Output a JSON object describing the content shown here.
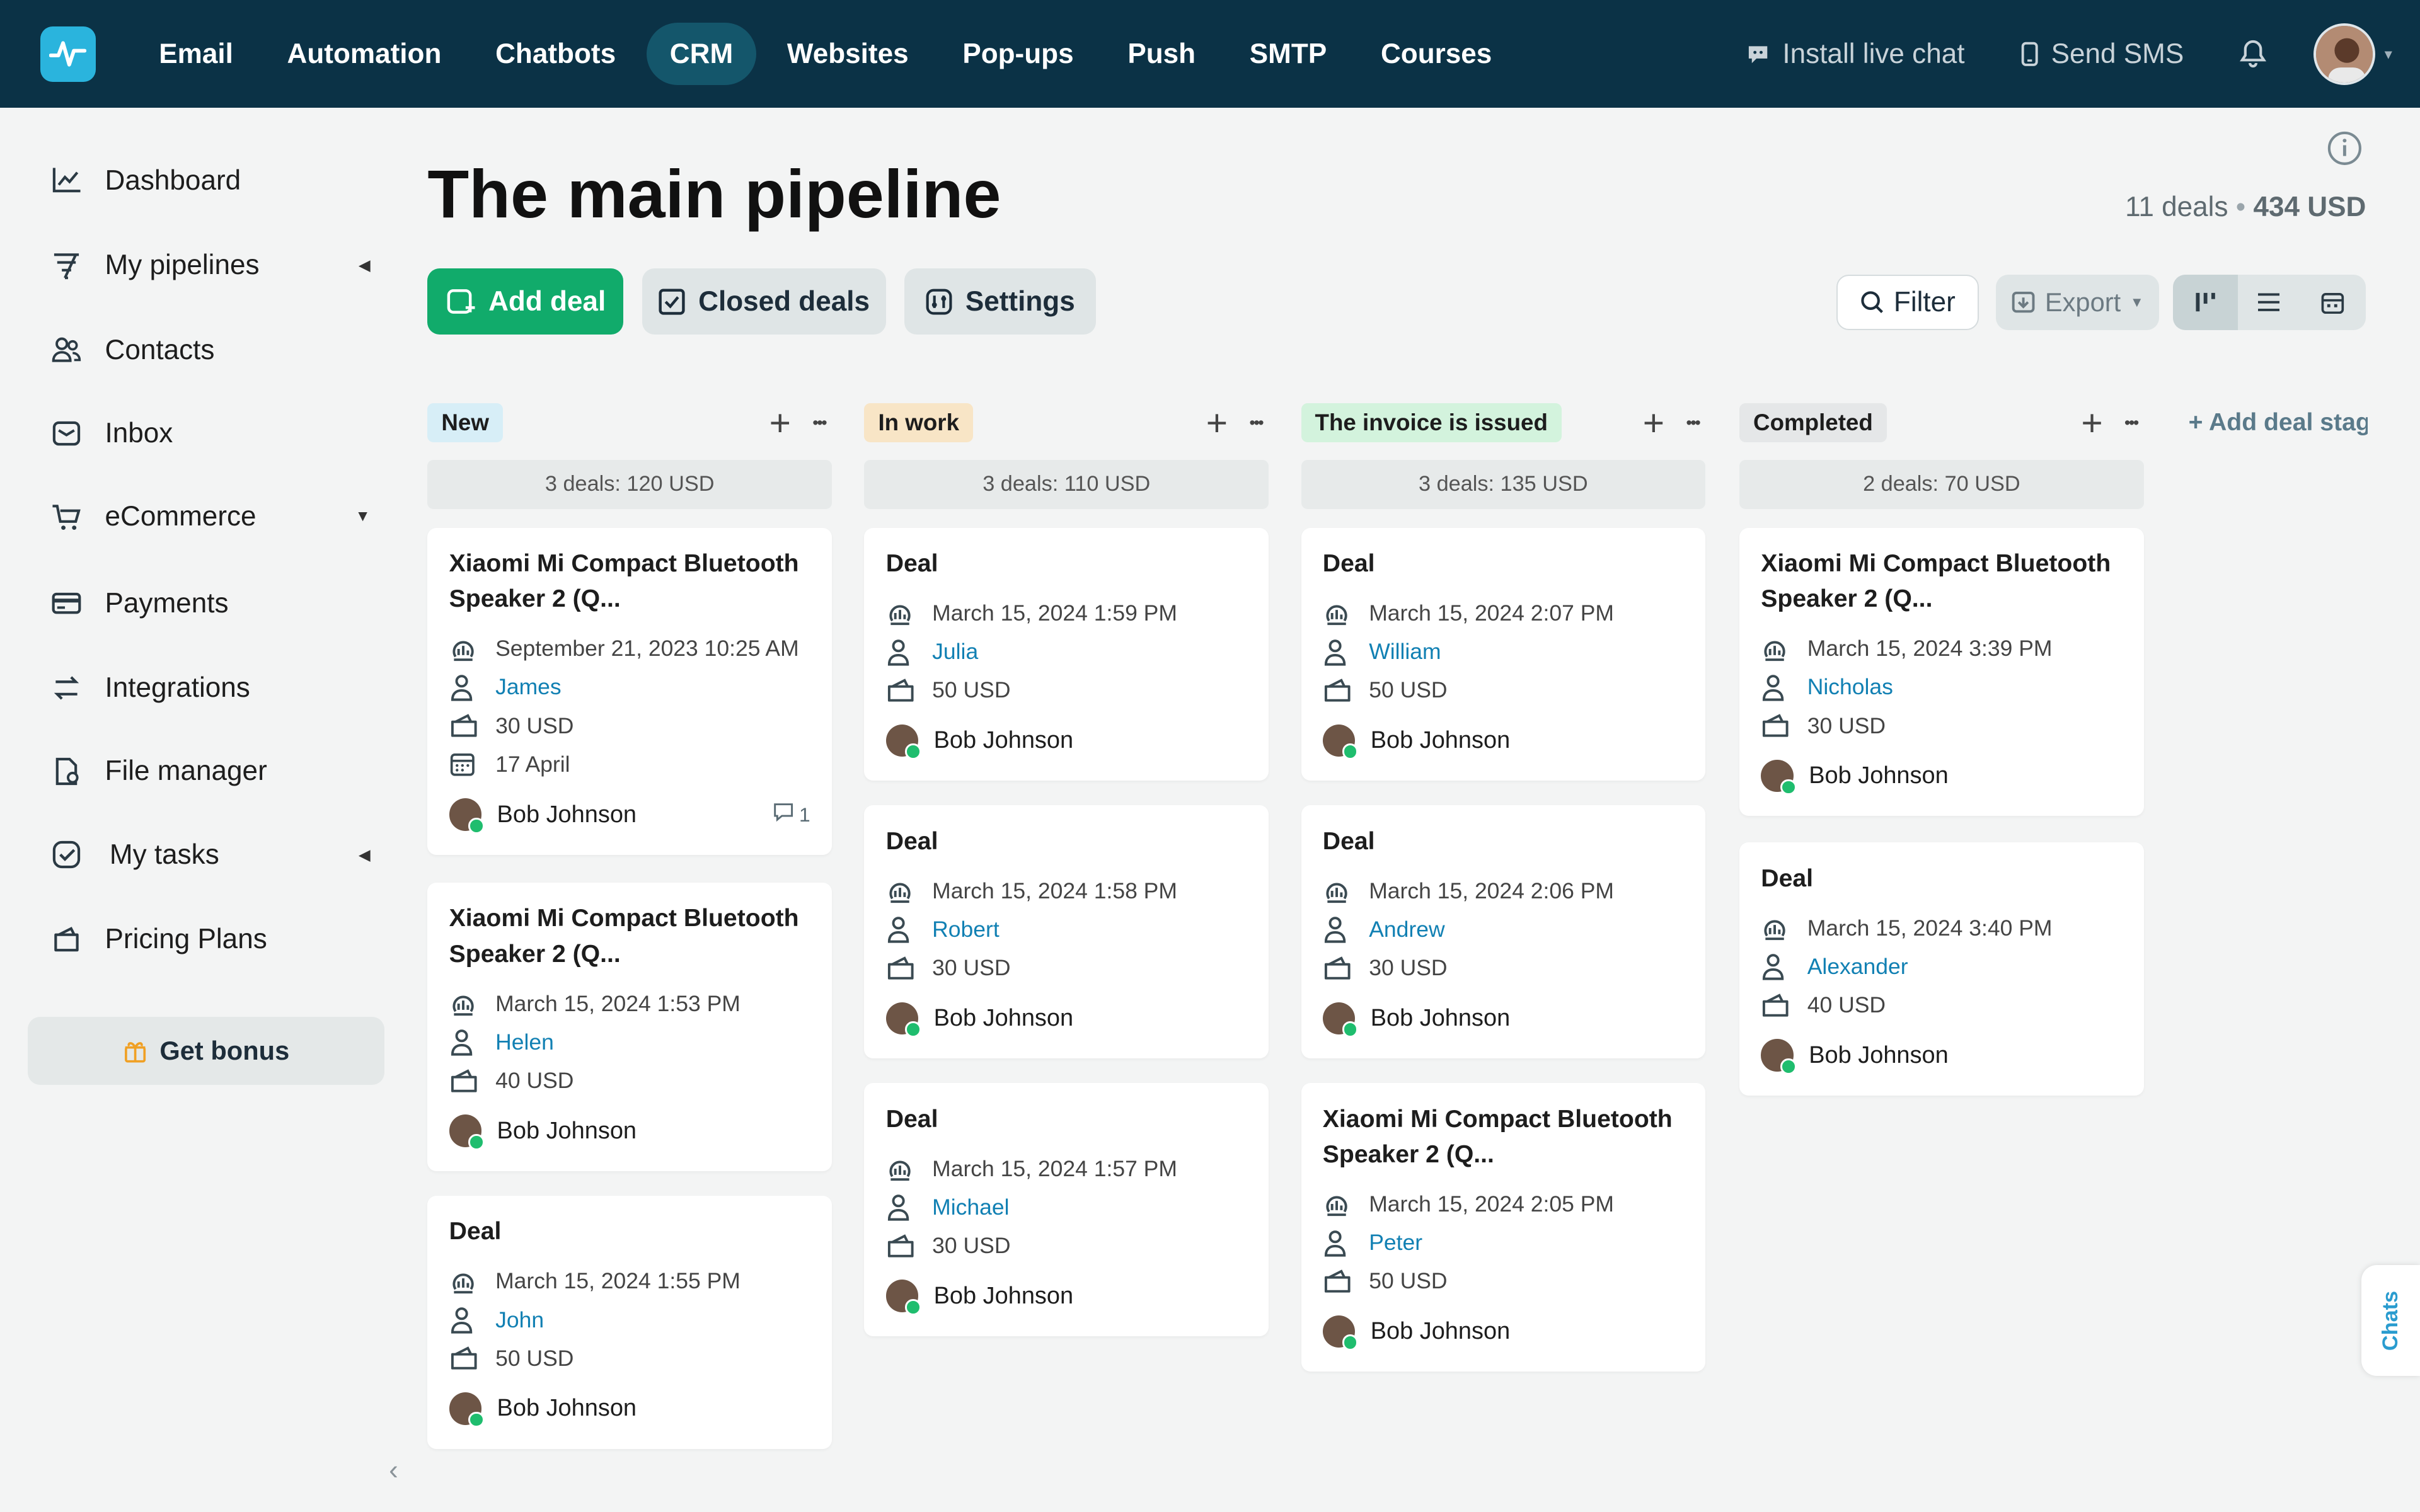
{
  "nav": {
    "items": [
      "Email",
      "Automation",
      "Chatbots",
      "CRM",
      "Websites",
      "Pop-ups",
      "Push",
      "SMTP",
      "Courses"
    ],
    "active": "CRM",
    "install_chat": "Install live chat",
    "send_sms": "Send SMS"
  },
  "sidebar": {
    "items": [
      {
        "label": "Dashboard",
        "icon": "chart-line-icon"
      },
      {
        "label": "My pipelines",
        "icon": "pipeline-icon"
      },
      {
        "label": "Contacts",
        "icon": "contacts-icon"
      },
      {
        "label": "Inbox",
        "icon": "inbox-icon"
      },
      {
        "label": "eCommerce",
        "icon": "cart-icon"
      },
      {
        "label": "Payments",
        "icon": "payments-icon"
      },
      {
        "label": "Integrations",
        "icon": "integrations-icon"
      },
      {
        "label": "File manager",
        "icon": "file-manager-icon"
      },
      {
        "label": "My tasks",
        "icon": "tasks-icon"
      },
      {
        "label": "Pricing Plans",
        "icon": "wallet-icon"
      }
    ],
    "bonus": "Get bonus"
  },
  "header": {
    "title": "The main pipeline",
    "deals_count": "11 deals",
    "total": "434 USD"
  },
  "toolbar": {
    "add_deal": "Add deal",
    "closed_deals": "Closed deals",
    "settings": "Settings",
    "filter": "Filter",
    "export": "Export"
  },
  "add_stage": "+ Add deal stage",
  "chats": "Chats",
  "columns": [
    {
      "name": "New",
      "color": "#d7eef7",
      "summary": "3 deals: 120 USD",
      "deals": [
        {
          "title": "Xiaomi Mi Compact Bluetooth Speaker 2 (Q...",
          "date": "September 21, 2023 10:25 AM",
          "contact": "James",
          "amount": "30 USD",
          "due": "17 April",
          "owner": "Bob Johnson",
          "comments": "1"
        },
        {
          "title": "Xiaomi Mi Compact Bluetooth Speaker 2 (Q...",
          "date": "March 15, 2024 1:53 PM",
          "contact": "Helen",
          "amount": "40 USD",
          "owner": "Bob Johnson"
        },
        {
          "title": "Deal",
          "date": "March 15, 2024 1:55 PM",
          "contact": "John",
          "amount": "50 USD",
          "owner": "Bob Johnson"
        }
      ]
    },
    {
      "name": "In work",
      "color": "#f8e5c6",
      "summary": "3 deals: 110 USD",
      "deals": [
        {
          "title": "Deal",
          "date": "March 15, 2024 1:59 PM",
          "contact": "Julia",
          "amount": "50 USD",
          "owner": "Bob Johnson"
        },
        {
          "title": "Deal",
          "date": "March 15, 2024 1:58 PM",
          "contact": "Robert",
          "amount": "30 USD",
          "owner": "Bob Johnson"
        },
        {
          "title": "Deal",
          "date": "March 15, 2024 1:57 PM",
          "contact": "Michael",
          "amount": "30 USD",
          "owner": "Bob Johnson"
        }
      ]
    },
    {
      "name": "The invoice is issued",
      "color": "#d3f3dd",
      "summary": "3 deals: 135 USD",
      "deals": [
        {
          "title": "Deal",
          "date": "March 15, 2024 2:07 PM",
          "contact": "William",
          "amount": "50 USD",
          "owner": "Bob Johnson"
        },
        {
          "title": "Deal",
          "date": "March 15, 2024 2:06 PM",
          "contact": "Andrew",
          "amount": "30 USD",
          "owner": "Bob Johnson"
        },
        {
          "title": "Xiaomi Mi Compact Bluetooth Speaker 2 (Q...",
          "date": "March 15, 2024 2:05 PM",
          "contact": "Peter",
          "amount": "50 USD",
          "owner": "Bob Johnson"
        }
      ]
    },
    {
      "name": "Completed",
      "color": "#e5e7e8",
      "summary": "2 deals: 70 USD",
      "deals": [
        {
          "title": "Xiaomi Mi Compact Bluetooth Speaker 2 (Q...",
          "date": "March 15, 2024 3:39 PM",
          "contact": "Nicholas",
          "amount": "30 USD",
          "owner": "Bob Johnson"
        },
        {
          "title": "Deal",
          "date": "March 15, 2024 3:40 PM",
          "contact": "Alexander",
          "amount": "40 USD",
          "owner": "Bob Johnson"
        }
      ]
    }
  ]
}
